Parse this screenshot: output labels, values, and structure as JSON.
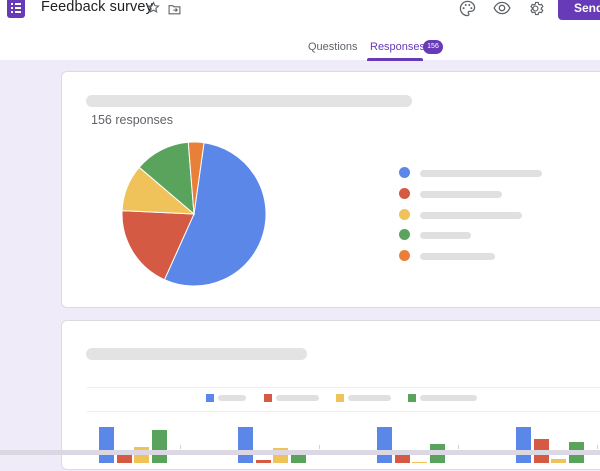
{
  "app": {
    "title": "Feedback survey",
    "send_label": "Send"
  },
  "header_icons": [
    "form-app-icon",
    "star-icon",
    "move-to-folder-icon",
    "palette-icon",
    "preview-eye-icon",
    "settings-gear-icon"
  ],
  "tabs": [
    {
      "label": "Questions",
      "active": false
    },
    {
      "label": "Responses",
      "active": true,
      "badge": "156"
    }
  ],
  "summary": {
    "response_count_label": "156 responses"
  },
  "colors": {
    "accent": "#673ab7",
    "blue": "#5b87e8",
    "red": "#d45a43",
    "yellow": "#f0c35a",
    "green": "#5aa35d",
    "orange": "#e8803a"
  },
  "chart_data": [
    {
      "type": "pie",
      "series": [
        {
          "color": "#5b87e8",
          "value": 54.5
        },
        {
          "color": "#d45a43",
          "value": 19.0
        },
        {
          "color": "#f0c35a",
          "value": 10.5
        },
        {
          "color": "#5aa35d",
          "value": 12.5
        },
        {
          "color": "#e8803a",
          "value": 3.5
        }
      ]
    },
    {
      "type": "bar",
      "categories": [
        "",
        "",
        "",
        ""
      ],
      "series": [
        {
          "color": "#5b87e8",
          "values": [
            36,
            36,
            36,
            36
          ]
        },
        {
          "color": "#d45a43",
          "values": [
            10,
            3,
            12,
            24
          ]
        },
        {
          "color": "#f0c35a",
          "values": [
            16,
            15,
            1,
            4
          ]
        },
        {
          "color": "#5aa35d",
          "values": [
            33,
            9,
            19,
            21
          ]
        }
      ]
    }
  ]
}
